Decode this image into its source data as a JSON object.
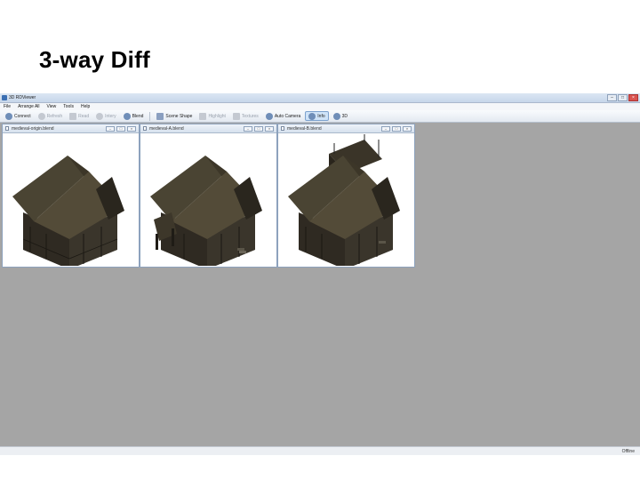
{
  "slide": {
    "title": "3-way Diff"
  },
  "window": {
    "title": "3D RDViewer",
    "controls": [
      "–",
      "□",
      "×"
    ]
  },
  "menu": [
    "File",
    "Arrange All",
    "View",
    "Tools",
    "Help"
  ],
  "toolbar": [
    {
      "label": "Connect",
      "icon": "connect-icon",
      "enabled": true
    },
    {
      "label": "Refresh",
      "icon": "refresh-icon",
      "enabled": false
    },
    {
      "label": "Read",
      "icon": "read-icon",
      "enabled": false
    },
    {
      "label": "Intery",
      "icon": "history-icon",
      "enabled": false
    },
    {
      "label": "Blend",
      "icon": "blend-icon",
      "enabled": true
    },
    {
      "label": "Scene Shape",
      "icon": "scene-shape-icon",
      "enabled": true
    },
    {
      "label": "Highlight",
      "icon": "highlight-icon",
      "enabled": false
    },
    {
      "label": "Textures",
      "icon": "textures-icon",
      "enabled": false
    },
    {
      "label": "Auto Camera",
      "icon": "auto-camera-icon",
      "enabled": true
    },
    {
      "label": "Info",
      "icon": "info-icon",
      "enabled": true,
      "active": true
    },
    {
      "label": "3D",
      "icon": "3d-icon",
      "enabled": true
    }
  ],
  "viewers": [
    {
      "title": "medieval-origin.blend",
      "variant": "origin"
    },
    {
      "title": "medieval-A.blend",
      "variant": "A"
    },
    {
      "title": "medieval-B.blend",
      "variant": "B"
    }
  ],
  "status": {
    "text": "Offline"
  }
}
